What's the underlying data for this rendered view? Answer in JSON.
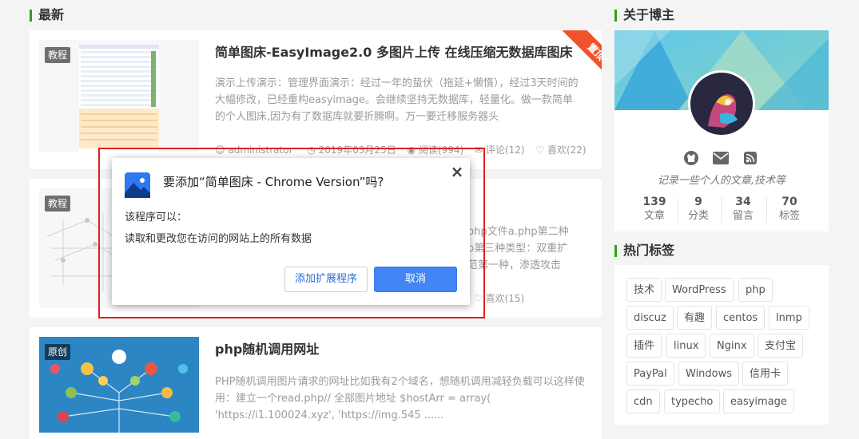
{
  "main": {
    "section_title": "最新",
    "posts": [
      {
        "badge": "教程",
        "title": "简单图床-EasyImage2.0 多图片上传 在线压缩无数据库图床",
        "excerpt": "演示上传演示：管理界面演示：经过一年的蛰伏（拖延+懒惰），经过3天时间的大幅修改，已经重构easyimage。会继续坚持无数据库，轻量化。做一款简单的个人图床,因为有了数据库就要折腾啊。万一要迁移服务器头",
        "ribbon": "置顶",
        "meta": {
          "author": "administrator",
          "date": "2019年03月25日",
          "views": "阅读(994)",
          "comments": "评论(12)",
          "likes": "喜欢(22)"
        }
      },
      {
        "badge": "教程",
        "excerpt_line1": "php文件a.php第二种",
        "excerpt_line2": "p第三种类型：双重扩",
        "excerpt_line3": "范第一种，渗透攻击",
        "likes": "喜欢(15)"
      },
      {
        "badge": "原创",
        "title": "php随机调用网址",
        "excerpt": "PHP随机调用图片请求的网址比如我有2个域名，想随机调用减轻负载可以这样使用：建立一个read.php// 全部图片地址 $hostArr = array( 'https://i1.100024.xyz', 'https://img.545 ......"
      }
    ]
  },
  "sidebar": {
    "about_title": "关于博主",
    "tagline": "记录一些个人的文章,技术等",
    "stats": [
      {
        "num": "139",
        "label": "文章"
      },
      {
        "num": "9",
        "label": "分类"
      },
      {
        "num": "34",
        "label": "留言"
      },
      {
        "num": "70",
        "label": "标签"
      }
    ],
    "social_icons": [
      "github-icon",
      "mail-icon",
      "rss-icon"
    ],
    "tags_title": "热门标签",
    "tags": [
      "技术",
      "WordPress",
      "php",
      "discuz",
      "有趣",
      "centos",
      "lnmp",
      "插件",
      "linux",
      "Nginx",
      "支付宝",
      "PayPal",
      "Windows",
      "信用卡",
      "cdn",
      "typecho",
      "easyimage"
    ]
  },
  "dialog": {
    "title": "要添加“简单图床 - Chrome Version”吗?",
    "subtitle": "该程序可以：",
    "permission": "读取和更改您在访问的网站上的所有数据",
    "add_button": "添加扩展程序",
    "cancel_button": "取消",
    "close_symbol": "×"
  },
  "colors": {
    "accent_green": "#2aa515",
    "primary_blue": "#4285f4",
    "highlight_red": "#e02020",
    "ribbon": "#f0522d"
  }
}
